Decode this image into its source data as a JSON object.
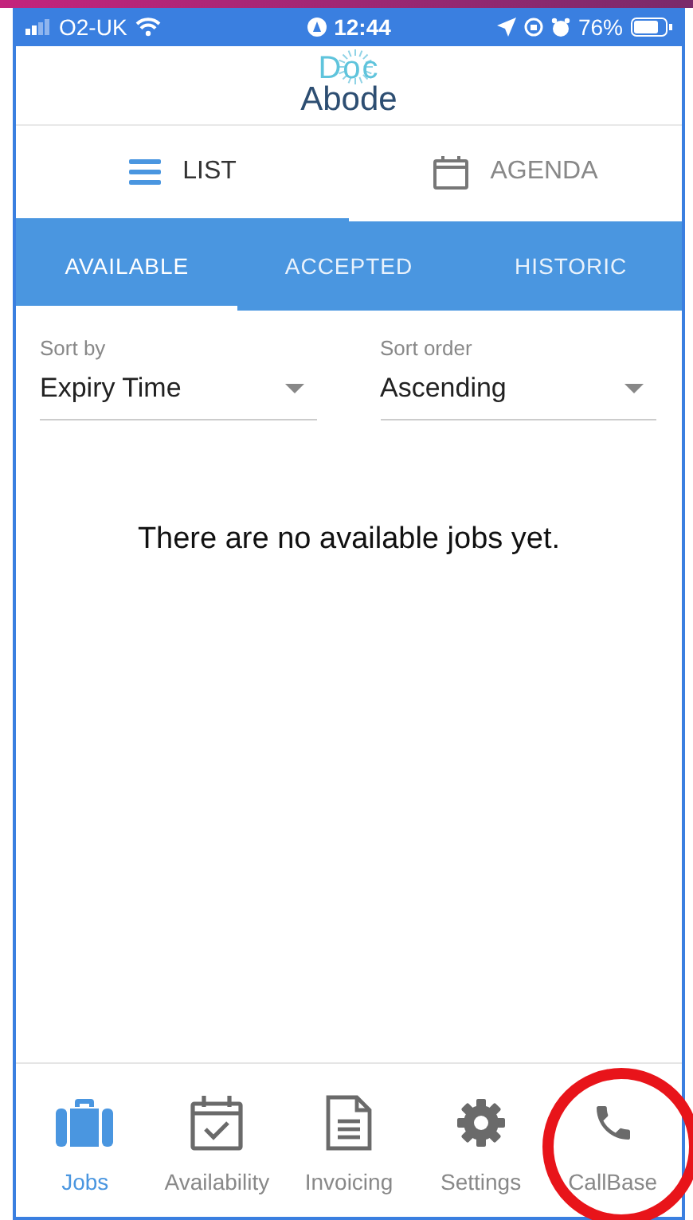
{
  "status_bar": {
    "carrier": "O2-UK",
    "time": "12:44",
    "battery": "76%"
  },
  "logo": {
    "line_1": "Doc",
    "line_2": "Abode"
  },
  "view_tabs": [
    {
      "label": "LIST",
      "kind": "list",
      "selected": true
    },
    {
      "label": "AGENDA",
      "kind": "calendar",
      "selected": false
    }
  ],
  "job_tabs": [
    {
      "label": "AVAILABLE",
      "selected": true
    },
    {
      "label": "ACCEPTED",
      "selected": false
    },
    {
      "label": "HISTORIC",
      "selected": false
    }
  ],
  "sort_fields": [
    {
      "label": "Sort by",
      "value": "Expiry Time"
    },
    {
      "label": "Sort order",
      "value": "Ascending"
    }
  ],
  "empty_message": "There are no available jobs yet.",
  "bottom_nav": [
    {
      "label": "Jobs",
      "kind": "briefcase",
      "selected": true
    },
    {
      "label": "Availability",
      "kind": "availability",
      "selected": false
    },
    {
      "label": "Invoicing",
      "kind": "invoicing",
      "selected": false
    },
    {
      "label": "Settings",
      "kind": "settings",
      "selected": false
    },
    {
      "label": "CallBase",
      "kind": "phone",
      "selected": false
    }
  ]
}
